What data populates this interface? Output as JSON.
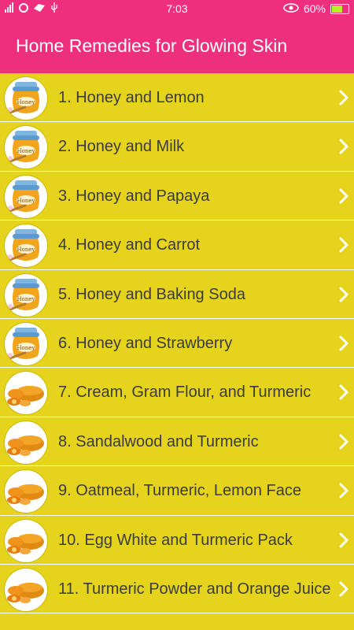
{
  "status": {
    "time": "7:03",
    "battery": "60%"
  },
  "appbar": {
    "title": "Home Remedies for Glowing Skin"
  },
  "list": {
    "items": [
      {
        "label": "1. Honey and Lemon",
        "icon": "honey-jar-icon"
      },
      {
        "label": "2. Honey and Milk",
        "icon": "honey-jar-icon"
      },
      {
        "label": "3. Honey and Papaya",
        "icon": "honey-jar-icon"
      },
      {
        "label": "4. Honey and Carrot",
        "icon": "honey-jar-icon"
      },
      {
        "label": "5. Honey and Baking Soda",
        "icon": "honey-jar-icon"
      },
      {
        "label": "6. Honey and Strawberry",
        "icon": "honey-jar-icon"
      },
      {
        "label": "7. Cream, Gram Flour, and Turmeric",
        "icon": "turmeric-icon"
      },
      {
        "label": "8. Sandalwood and Turmeric",
        "icon": "turmeric-icon"
      },
      {
        "label": "9. Oatmeal, Turmeric, Lemon Face",
        "icon": "turmeric-icon"
      },
      {
        "label": "10. Egg White and Turmeric Pack",
        "icon": "turmeric-icon"
      },
      {
        "label": "11. Turmeric Powder and Orange Juice",
        "icon": "turmeric-icon"
      }
    ],
    "honey_jar_label": "Honey"
  },
  "colors": {
    "accent": "#ee2f7d",
    "list_bg": "#e6d41c",
    "text": "#3b3b3b"
  }
}
